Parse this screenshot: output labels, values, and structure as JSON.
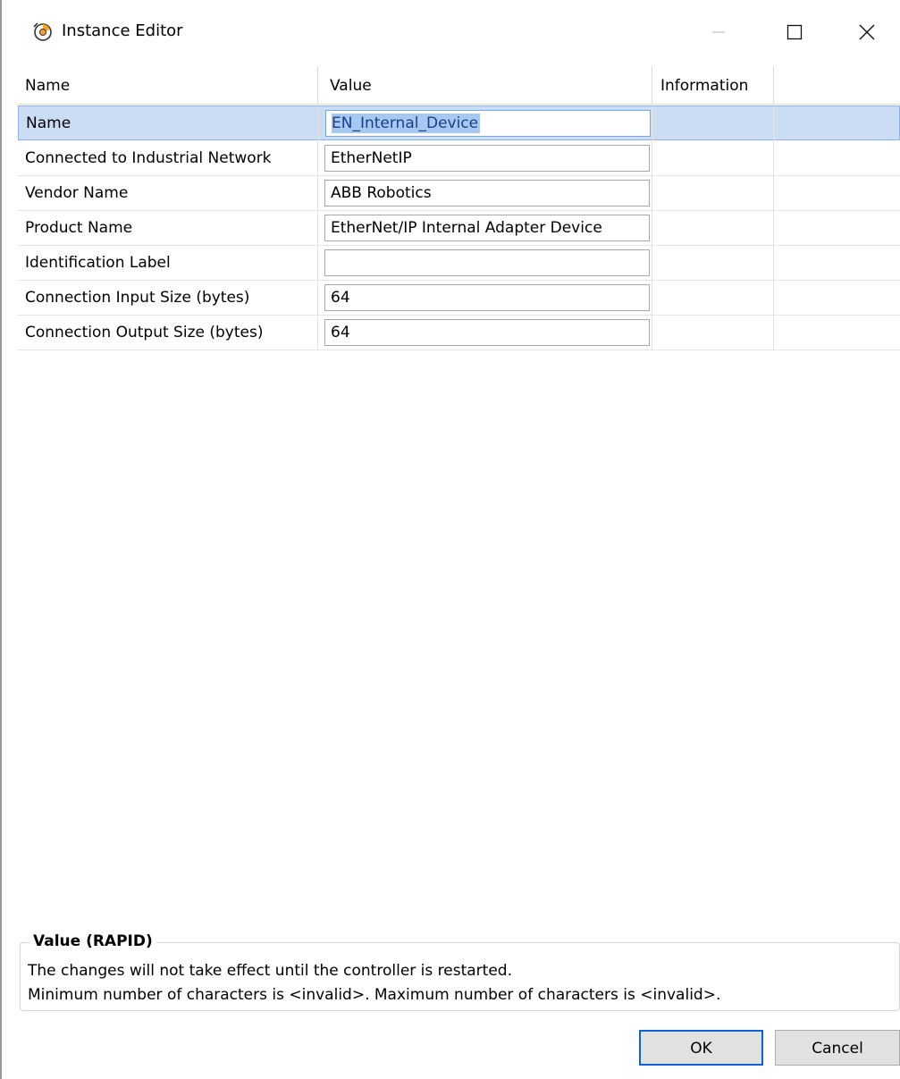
{
  "window": {
    "title": "Instance Editor",
    "icon": "instance-editor-icon"
  },
  "grid": {
    "columns": [
      "Name",
      "Value",
      "Information",
      ""
    ],
    "rows": [
      {
        "name": "Name",
        "value": "EN_Internal_Device",
        "information": ""
      },
      {
        "name": "Connected to Industrial Network",
        "value": "EtherNetIP",
        "information": ""
      },
      {
        "name": "Vendor Name",
        "value": "ABB Robotics",
        "information": ""
      },
      {
        "name": "Product Name",
        "value": "EtherNet/IP Internal Adapter Device",
        "information": ""
      },
      {
        "name": "Identification Label",
        "value": "",
        "information": ""
      },
      {
        "name": "Connection Input Size (bytes)",
        "value": "64",
        "information": ""
      },
      {
        "name": "Connection Output Size (bytes)",
        "value": "64",
        "information": ""
      }
    ],
    "selected_row": 0
  },
  "info_panel": {
    "heading": "Value (RAPID)",
    "line1": "The changes will not take effect until the controller is restarted.",
    "line2": "Minimum number of characters is <invalid>. Maximum number of characters is <invalid>."
  },
  "buttons": {
    "ok_label": "OK",
    "cancel_label": "Cancel"
  },
  "colors": {
    "selection_background": "#cbdcf5",
    "text_selection": "#a7c8f0",
    "default_button_border": "#0a64d6"
  }
}
